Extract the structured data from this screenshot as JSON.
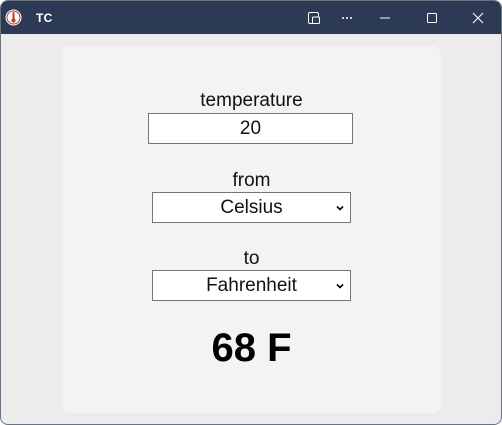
{
  "window": {
    "title": "TC",
    "controls": [
      "pin-icon",
      "more-icon",
      "minimize-icon",
      "maximize-icon",
      "close-icon"
    ]
  },
  "form": {
    "temperature_label": "temperature",
    "temperature_value": "20",
    "from_label": "from",
    "from_value": "Celsius",
    "to_label": "to",
    "to_value": "Fahrenheit"
  },
  "result": {
    "text": "68 F"
  },
  "colors": {
    "titlebar": "#2d3a55",
    "background": "#ececec",
    "panel": "#f3f3f3"
  }
}
